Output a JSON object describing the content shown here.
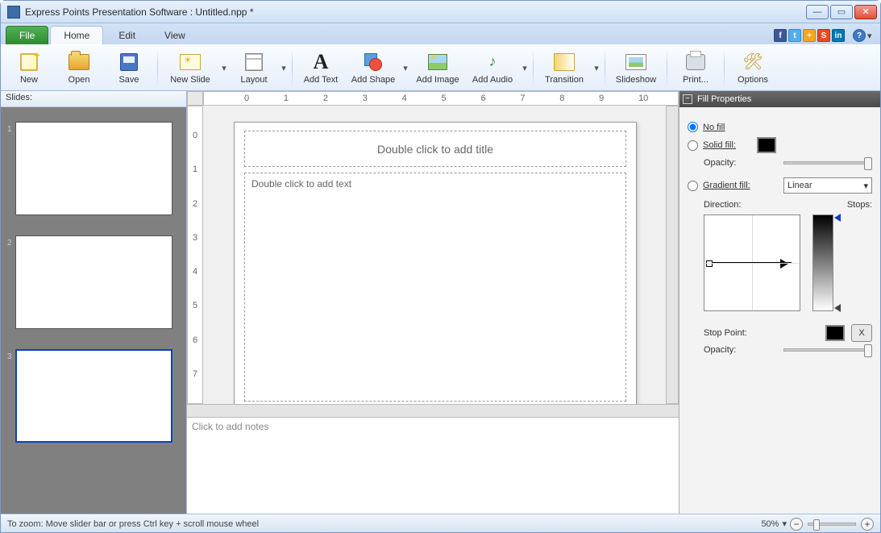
{
  "titlebar": {
    "app_title": "Express Points Presentation Software : Untitled.npp *"
  },
  "menu": {
    "file": "File",
    "home": "Home",
    "edit": "Edit",
    "view": "View"
  },
  "social": {
    "fb": "f",
    "tw": "t",
    "gp": "+",
    "su": "S",
    "li": "in",
    "help": "?"
  },
  "ribbon": {
    "new": "New",
    "open": "Open",
    "save": "Save",
    "newslide": "New Slide",
    "layout": "Layout",
    "addtext": "Add Text",
    "addshape": "Add Shape",
    "addimage": "Add Image",
    "addaudio": "Add Audio",
    "transition": "Transition",
    "slideshow": "Slideshow",
    "print": "Print...",
    "options": "Options"
  },
  "slides": {
    "header": "Slides:",
    "items": [
      {
        "n": "1"
      },
      {
        "n": "2"
      },
      {
        "n": "3"
      }
    ],
    "selected_index": 2
  },
  "ruler": {
    "h": [
      "0",
      "1",
      "2",
      "3",
      "4",
      "5",
      "6",
      "7",
      "8",
      "9",
      "10"
    ],
    "v": [
      "0",
      "1",
      "2",
      "3",
      "4",
      "5",
      "6",
      "7"
    ]
  },
  "canvas": {
    "title_placeholder": "Double click to add title",
    "body_placeholder": "Double click to add text"
  },
  "notes": {
    "placeholder": "Click to add notes"
  },
  "fillpanel": {
    "header": "Fill Properties",
    "nofill": "No fill",
    "solid": "Solid fill:",
    "opacity": "Opacity:",
    "gradient": "Gradient fill:",
    "gradient_type": "Linear",
    "direction": "Direction:",
    "stops": "Stops:",
    "stoppoint": "Stop Point:",
    "x": "X",
    "selected": "nofill",
    "solid_color": "#000000",
    "stop_color": "#000000"
  },
  "status": {
    "hint": "To zoom: Move slider bar or press Ctrl key + scroll mouse wheel",
    "zoom": "50%"
  }
}
